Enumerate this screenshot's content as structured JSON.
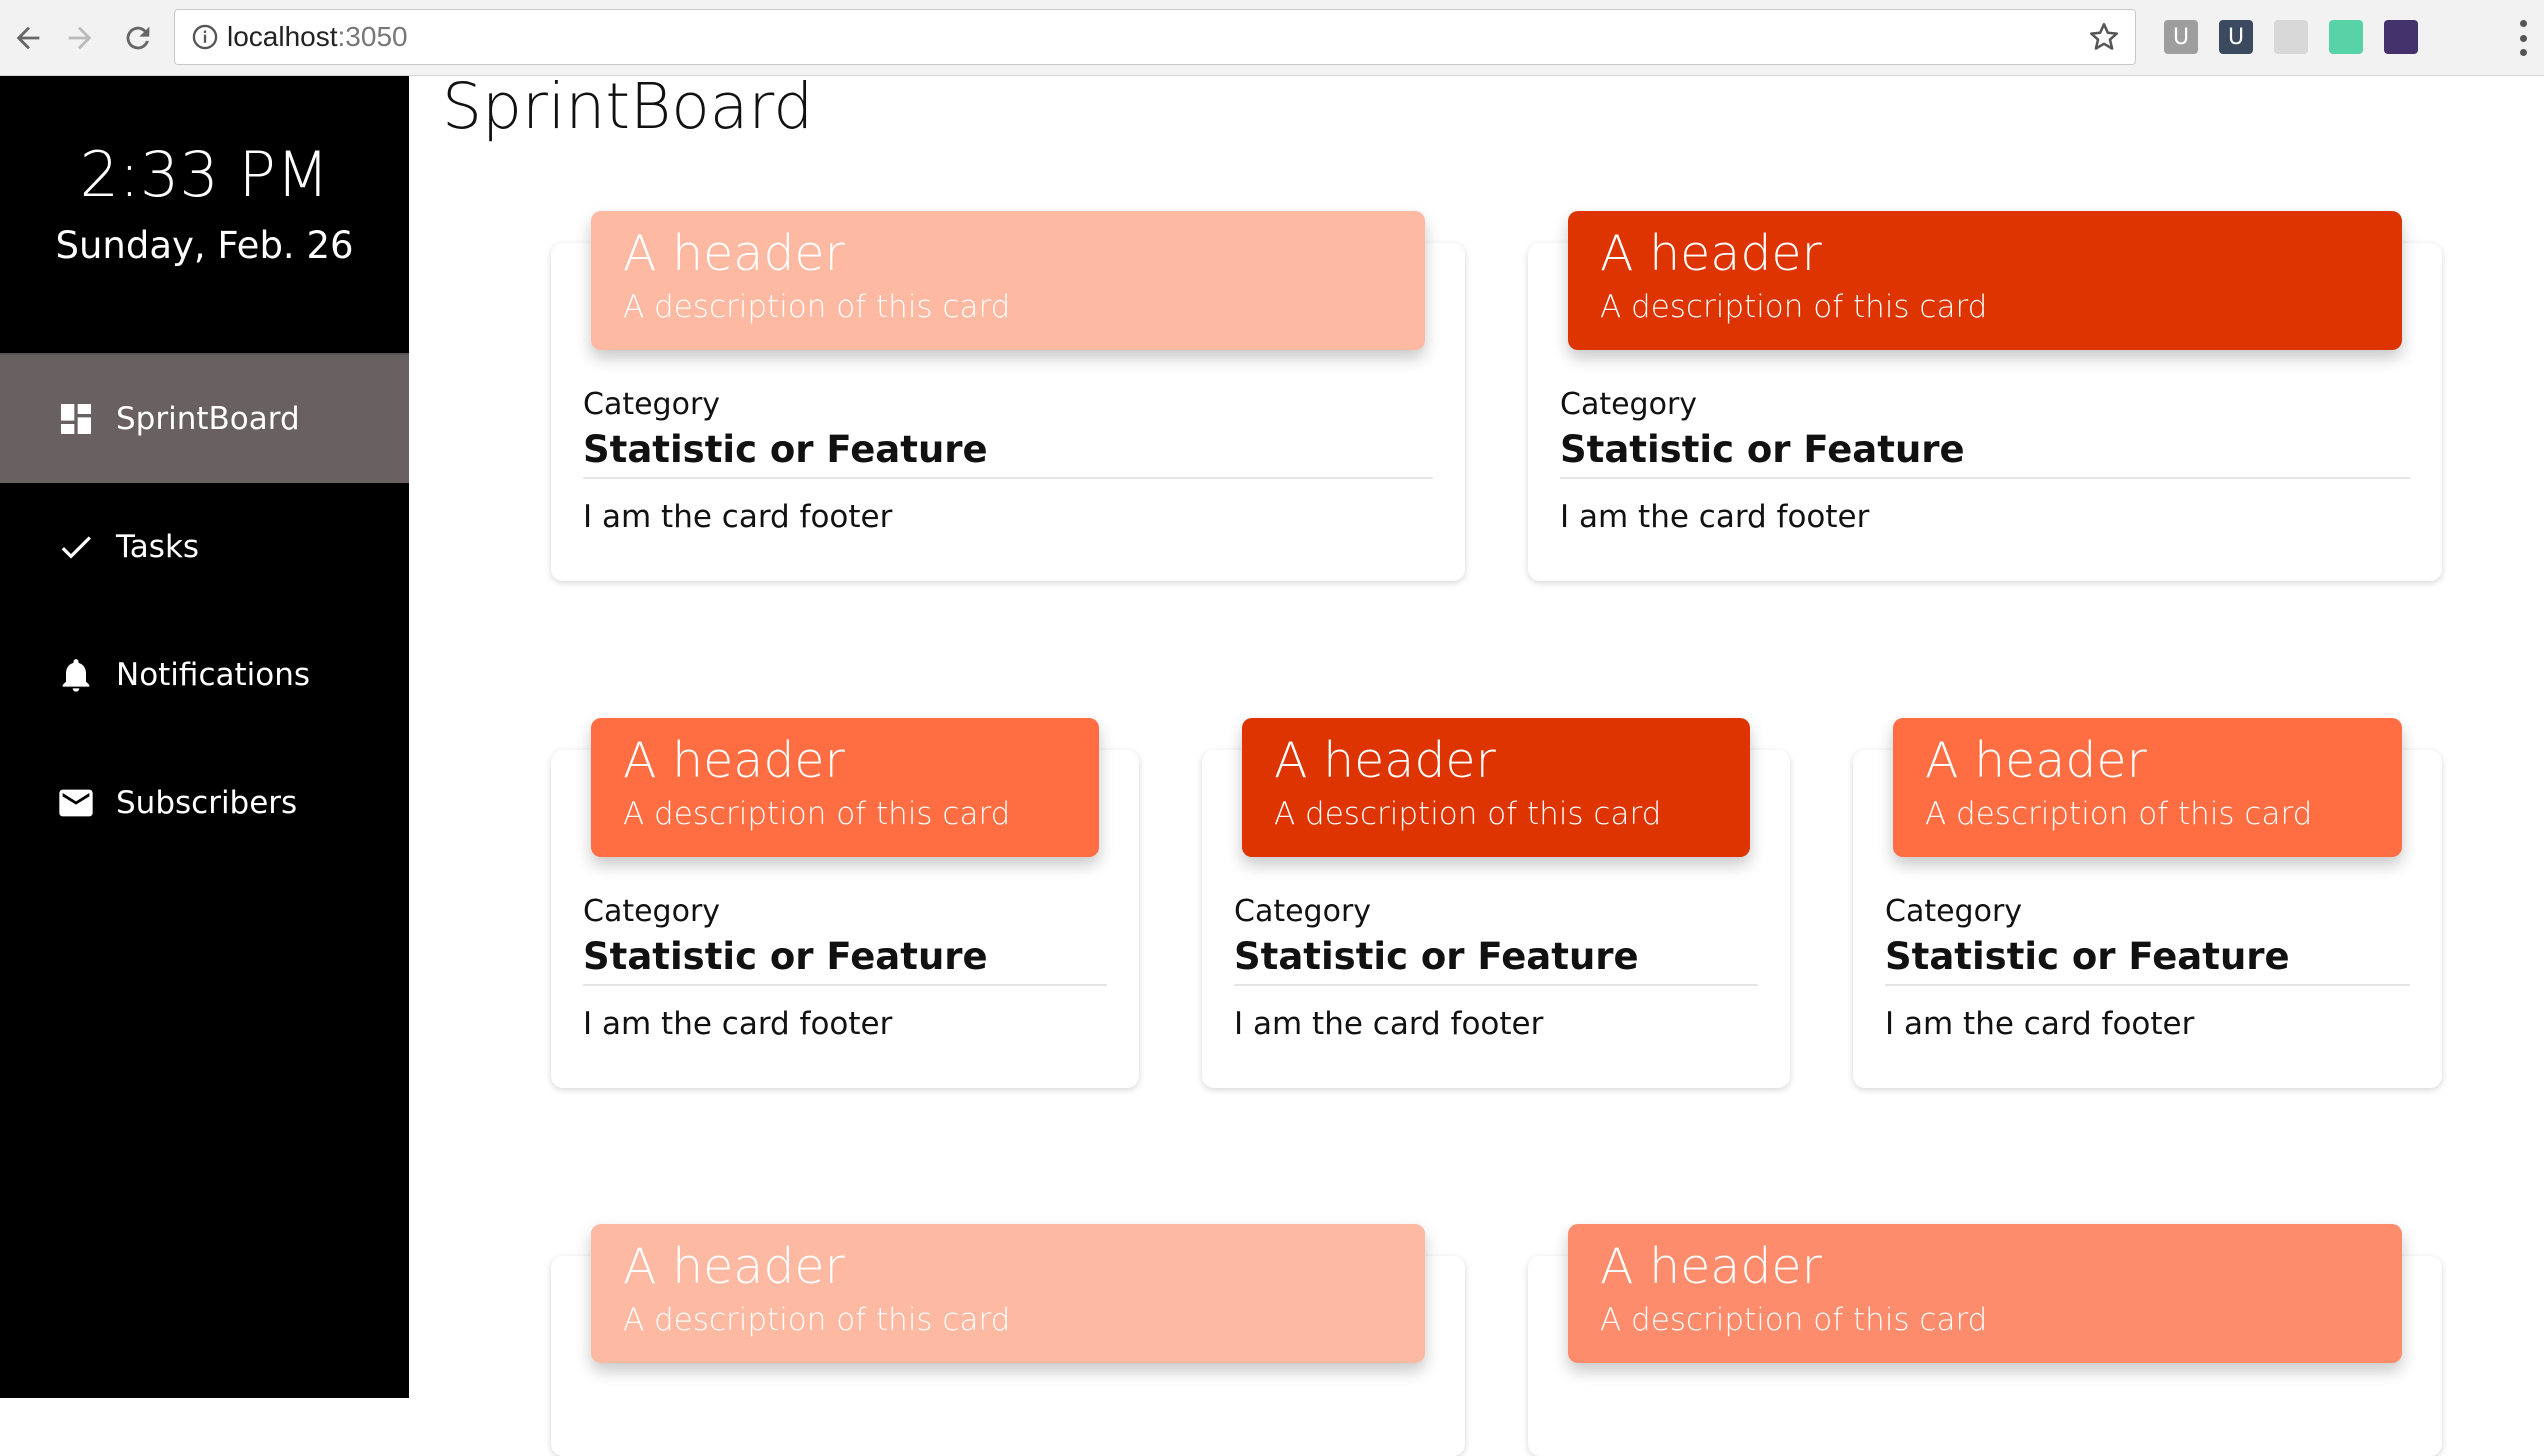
{
  "browser": {
    "url_host": "localhost",
    "url_port": ":3050",
    "extensions": [
      {
        "icon": "u-extension-icon",
        "label": "U",
        "color": "#9e9e9e"
      },
      {
        "icon": "u-shield-extension-icon",
        "label": "U",
        "color": "#3b4a5e"
      },
      {
        "icon": "react-extension-icon",
        "label": "",
        "color": "#d8d8d8"
      },
      {
        "icon": "color-wheel-extension-icon",
        "label": "",
        "color": "#58d3a7"
      },
      {
        "icon": "redux-extension-icon",
        "label": "",
        "color": "#43326b"
      },
      {
        "icon": "screenshot-extension-icon",
        "label": "",
        "color": "#f2f2f2"
      }
    ]
  },
  "sidebar": {
    "time": "2:33 PM",
    "date": "Sunday, Feb. 26",
    "items": [
      {
        "label": "SprintBoard",
        "icon": "dashboard-icon",
        "active": true
      },
      {
        "label": "Tasks",
        "icon": "checkmark-icon",
        "active": false
      },
      {
        "label": "Notifications",
        "icon": "bell-icon",
        "active": false
      },
      {
        "label": "Subscribers",
        "icon": "envelope-icon",
        "active": false
      }
    ]
  },
  "main": {
    "title": "SprintBoard",
    "cards": [
      {
        "header": "A header",
        "description": "A description of this card",
        "category": "Category",
        "statistic": "Statistic or Feature",
        "footer": "I am the card footer",
        "color": "#fdb9a2"
      },
      {
        "header": "A header",
        "description": "A description of this card",
        "category": "Category",
        "statistic": "Statistic or Feature",
        "footer": "I am the card footer",
        "color": "#dd3402"
      },
      {
        "header": "A header",
        "description": "A description of this card",
        "category": "Category",
        "statistic": "Statistic or Feature",
        "footer": "I am the card footer",
        "color": "#ff6e43"
      },
      {
        "header": "A header",
        "description": "A description of this card",
        "category": "Category",
        "statistic": "Statistic or Feature",
        "footer": "I am the card footer",
        "color": "#dd3402"
      },
      {
        "header": "A header",
        "description": "A description of this card",
        "category": "Category",
        "statistic": "Statistic or Feature",
        "footer": "I am the card footer",
        "color": "#ff6e43"
      },
      {
        "header": "A header",
        "description": "A description of this card",
        "color": "#fdb9a2"
      },
      {
        "header": "A header",
        "description": "A description of this card",
        "color": "#fc8c6c"
      }
    ]
  }
}
